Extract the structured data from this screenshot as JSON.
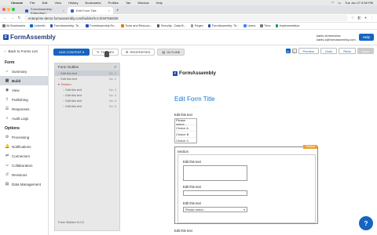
{
  "mac": {
    "app": "Chrome",
    "menus": [
      "File",
      "Edit",
      "View",
      "History",
      "Bookmarks",
      "Profiles",
      "Tab",
      "Window",
      "Help"
    ],
    "time": "Tue Jun 27  6:59 PM"
  },
  "tabs": [
    {
      "label": "FormAssembly: Enterprise |"
    },
    {
      "label": "Edit Form Title"
    }
  ],
  "address": {
    "url": "enterprise-demo.formassembly.com/builder/5.0.0/497569/28"
  },
  "bookmarks": [
    {
      "label": "All Bookmarks",
      "color": "#777"
    },
    {
      "label": "LinkedIn",
      "color": "#0a66c2"
    },
    {
      "label": "FormAssembly: Te...",
      "color": "#1f4fb2"
    },
    {
      "label": "FormAssembly En...",
      "color": "#1f4fb2"
    },
    {
      "label": "Tools and Resourc...",
      "color": "#e07b00"
    },
    {
      "label": "Security - Data B...",
      "color": "#555"
    },
    {
      "label": "Regex",
      "color": "#999"
    },
    {
      "label": "FormAssembly: Te...",
      "color": "#1f4fb2"
    },
    {
      "label": "Users",
      "color": "#4285f4"
    },
    {
      "label": "Time",
      "color": "#777"
    },
    {
      "label": "Implementation",
      "color": "#0f9d58"
    }
  ],
  "app": {
    "logo": "FormAssembly",
    "user_name": "karlis strimenieks",
    "user_email": "karlis.s@formassembly.com",
    "help": "Help"
  },
  "sidebar": {
    "back": "Back to Forms List",
    "form_heading": "Form",
    "form_items": [
      {
        "label": "Summary",
        "icon": "⌂"
      },
      {
        "label": "Build",
        "icon": "▦"
      },
      {
        "label": "View",
        "icon": "◉"
      },
      {
        "label": "Publishing",
        "icon": "⇪"
      },
      {
        "label": "Responses",
        "icon": "☰"
      },
      {
        "label": "Audit Logs",
        "icon": "⌕"
      }
    ],
    "options_heading": "Options",
    "option_items": [
      {
        "label": "Processing",
        "icon": "⚙"
      },
      {
        "label": "Notifications",
        "icon": "🔔"
      },
      {
        "label": "Connectors",
        "icon": "⇄"
      },
      {
        "label": "Collaboration",
        "icon": "☺"
      },
      {
        "label": "Revisions",
        "icon": "↺"
      },
      {
        "label": "Data Management",
        "icon": "▤"
      }
    ]
  },
  "toolbar": {
    "add_content": "ADD CONTENT ▾",
    "themes": "THEMES",
    "properties": "PROPERTIES",
    "outline": "OUTLINE",
    "preview": "Preview",
    "undo": "Undo",
    "redo": "Redo",
    "save": "Save"
  },
  "outline": {
    "title": "Form Outline",
    "rows": [
      {
        "label": "Edit this text",
        "no": "No. 1"
      },
      {
        "label": "Edit this text",
        "no": "No. 2"
      },
      {
        "label": "Section",
        "no": ""
      },
      {
        "label": "Edit this text",
        "no": "No. 3"
      },
      {
        "label": "Edit this text",
        "no": "No. 4"
      },
      {
        "label": "Edit this text",
        "no": "No. 5"
      },
      {
        "label": "Edit this text",
        "no": "No. 6"
      }
    ],
    "version": "Form Builder 5.0.0"
  },
  "form": {
    "logo": "FormAssembly",
    "title": "Edit Form Title",
    "q1": "Edit this text",
    "list_options": [
      "Please select...",
      "Choice A",
      "Choice B",
      "Choice C"
    ],
    "section_label": "Section",
    "section_badge": "Section",
    "s_q1": "Edit this text",
    "s_q2": "Edit this text",
    "s_q3": "Edit this text",
    "select_value": "Please select...",
    "after": "Edit this text"
  }
}
